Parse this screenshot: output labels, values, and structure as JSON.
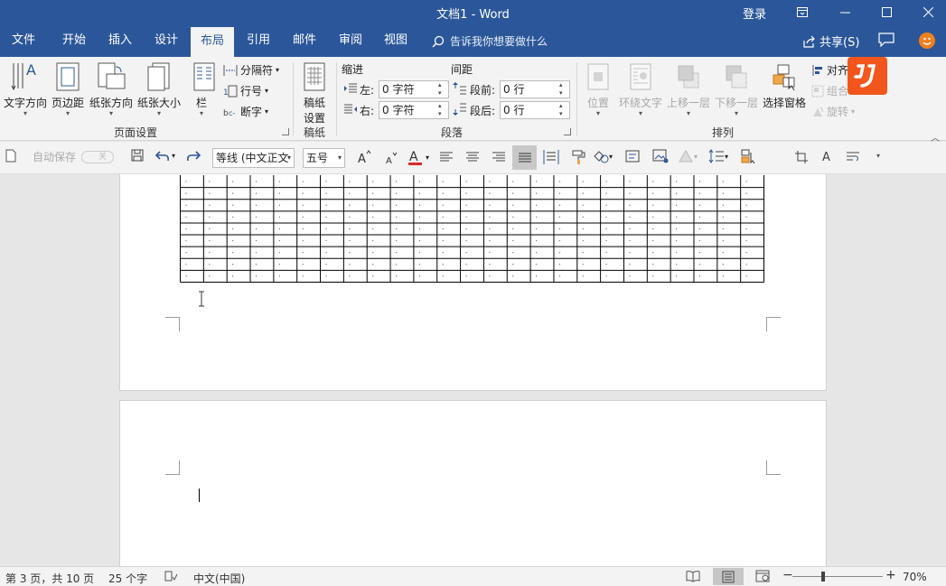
{
  "window": {
    "title": "文档1  -  Word",
    "login": "登录"
  },
  "tabs": [
    "文件",
    "开始",
    "插入",
    "设计",
    "布局",
    "引用",
    "邮件",
    "审阅",
    "视图"
  ],
  "active_tab": "布局",
  "tell_me": "告诉我你想要做什么",
  "share_label": "共享(S)",
  "ribbon": {
    "page_setup": {
      "label": "页面设置",
      "text_direction": "文字方向",
      "margins": "页边距",
      "orientation": "纸张方向",
      "size": "纸张大小",
      "columns": "栏",
      "breaks": "分隔符",
      "line_numbers": "行号",
      "hyphenation": "断字"
    },
    "draft_paper": {
      "label": "稿纸",
      "button": "稿纸\n设置",
      "line1": "稿纸",
      "line2": "设置"
    },
    "paragraph": {
      "label": "段落",
      "indent_header": "缩进",
      "spacing_header": "间距",
      "indent_left_label": "左:",
      "indent_left_value": "0 字符",
      "indent_right_label": "右:",
      "indent_right_value": "0 字符",
      "before_label": "段前:",
      "before_value": "0 行",
      "after_label": "段后:",
      "after_value": "0 行"
    },
    "arrange": {
      "label": "排列",
      "position": "位置",
      "wrap_text": "环绕文字",
      "bring_forward": "上移一层",
      "send_backward": "下移一层",
      "selection_pane": "选择窗格",
      "align": "对齐",
      "group": "组合",
      "rotate": "旋转"
    }
  },
  "qat": {
    "autosave_label": "自动保存",
    "autosave_state": "关",
    "font_name": "等线 (中文正文",
    "font_size": "五号"
  },
  "status": {
    "page": "第 3 页，共 10 页",
    "words": "25 个字",
    "language": "中文(中国)",
    "zoom": "70%"
  },
  "colors": {
    "brand": "#2b579a",
    "ribbon_bg": "#f3f3f3",
    "logo": "#f2561d",
    "font_color_bar": "#d92b2b"
  },
  "grid": {
    "columns": 25,
    "rows": 9
  }
}
